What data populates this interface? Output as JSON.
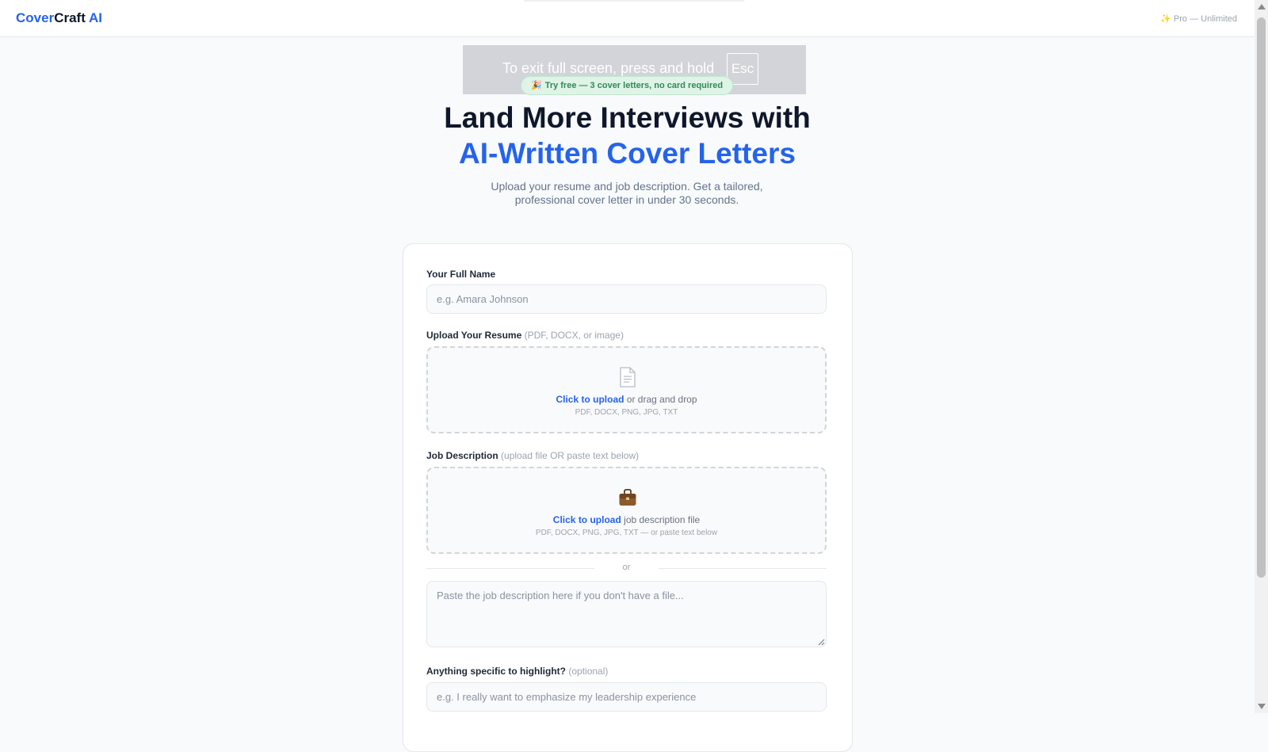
{
  "header": {
    "logo": {
      "part1": "Cover",
      "part2": "Craft",
      "part3": " AI"
    },
    "plan_badge": "Pro — Unlimited",
    "plan_icon": "sparkles-icon"
  },
  "fullscreen_notice": {
    "text": "To exit full screen, press and hold",
    "key": "Esc"
  },
  "hero": {
    "badge": "Try free — 3 cover letters, no card required",
    "badge_icon": "party-popper-icon",
    "title_line1": "Land More Interviews with",
    "title_line2": "AI-Written Cover Letters",
    "subtitle": "Upload your resume and job description. Get a tailored, professional cover letter in under 30 seconds."
  },
  "form": {
    "name": {
      "label": "Your Full Name",
      "placeholder": "e.g. Amara Johnson"
    },
    "resume": {
      "label": "Upload Your Resume",
      "hint": "(PDF, DOCX, or image)",
      "icon": "document-icon",
      "link": "Click to upload",
      "line1_rest": " or drag and drop",
      "formats": "PDF, DOCX, PNG, JPG, TXT"
    },
    "job": {
      "label": "Job Description",
      "hint": "(upload file OR paste text below)",
      "icon": "briefcase-icon",
      "link": "Click to upload",
      "line1_rest": " job description file",
      "formats": "PDF, DOCX, PNG, JPG, TXT — or paste text below"
    },
    "divider_text": "or",
    "job_text": {
      "placeholder": "Paste the job description here if you don't have a file..."
    },
    "highlight": {
      "label": "Anything specific to highlight?",
      "hint": "(optional)",
      "placeholder": "e.g. I really want to emphasize my leadership experience"
    }
  },
  "colors": {
    "brand": "#2563eb",
    "success": "#2f8b57",
    "text": "#0f172a",
    "muted": "#64748b"
  }
}
